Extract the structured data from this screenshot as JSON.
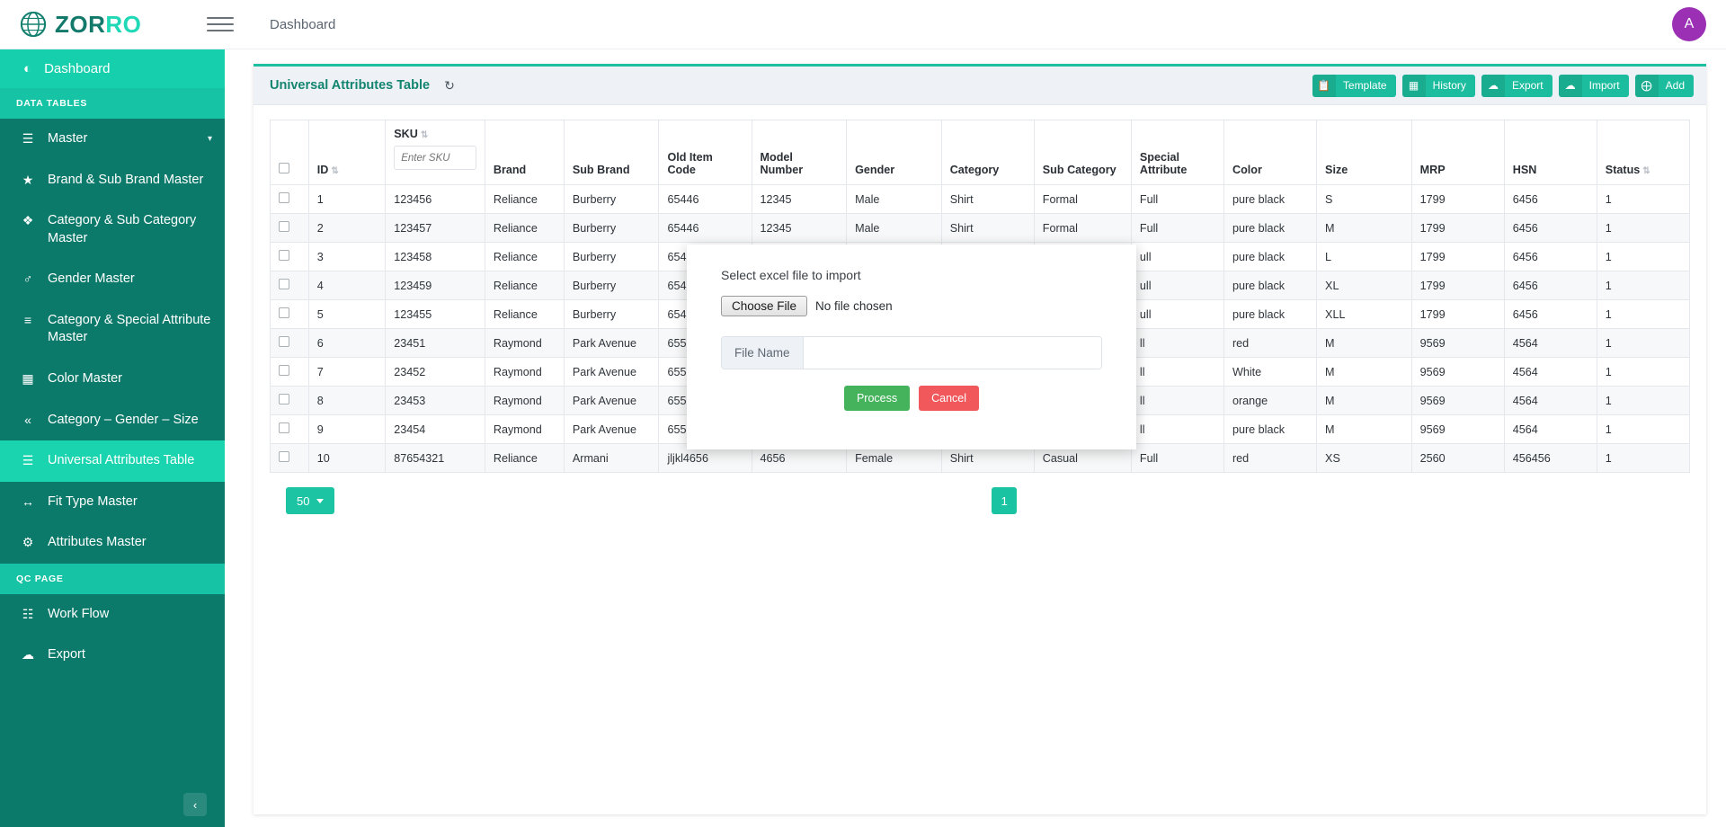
{
  "brand": {
    "text_dark": "ZOR",
    "text_light": "RO",
    "logo_icon": "globe-icon"
  },
  "topbar": {
    "menu_toggle_icon": "hamburger-icon",
    "breadcrumb": "Dashboard",
    "avatar_initial": "A",
    "avatar_color": "#9b30b5"
  },
  "sidebar": {
    "dashboard": {
      "label": "Dashboard",
      "icon": "dashboard-icon"
    },
    "sections": [
      {
        "title": "DATA TABLES",
        "items": [
          {
            "label": "Master",
            "icon": "layers-icon",
            "active": false,
            "chevron": "⌄"
          },
          {
            "label": "Brand & Sub Brand Master",
            "icon": "star-icon",
            "active": false
          },
          {
            "label": "Category & Sub Category Master",
            "icon": "stack-icon",
            "active": false
          },
          {
            "label": "Gender Master",
            "icon": "gender-icon",
            "active": false
          },
          {
            "label": "Category & Special Attribute Master",
            "icon": "sliders-icon",
            "active": false
          },
          {
            "label": "Color Master",
            "icon": "grid-icon",
            "active": false
          },
          {
            "label": "Category – Gender – Size",
            "icon": "chevrons-icon",
            "active": false
          },
          {
            "label": "Universal Attributes Table",
            "icon": "list-icon",
            "active": true
          },
          {
            "label": "Fit Type Master",
            "icon": "arrows-h-icon",
            "active": false
          },
          {
            "label": "Attributes Master",
            "icon": "cogs-icon",
            "active": false
          }
        ]
      },
      {
        "title": "QC PAGE",
        "items": [
          {
            "label": "Work Flow",
            "icon": "tasks-icon",
            "active": false
          },
          {
            "label": "Export",
            "icon": "cloud-upload-icon",
            "active": false
          }
        ]
      }
    ],
    "collapse_icon": "‹"
  },
  "card": {
    "title": "Universal Attributes Table",
    "refresh_icon": "refresh-icon",
    "accent_color": "#1dbfa0",
    "actions": [
      {
        "label": "Template",
        "icon": "copy-icon"
      },
      {
        "label": "History",
        "icon": "table-icon"
      },
      {
        "label": "Export",
        "icon": "cloud-upload-icon"
      },
      {
        "label": "Import",
        "icon": "cloud-download-icon"
      },
      {
        "label": "Add",
        "icon": "plus-circle-icon"
      }
    ]
  },
  "table": {
    "select_all_checkbox": false,
    "sku_filter": {
      "value": "",
      "placeholder": "Enter SKU"
    },
    "columns": [
      {
        "key": "cb",
        "label": "",
        "sortable": false
      },
      {
        "key": "id",
        "label": "ID",
        "sortable": true
      },
      {
        "key": "sku",
        "label": "SKU",
        "sortable": true,
        "filter": true
      },
      {
        "key": "brand",
        "label": "Brand",
        "sortable": false
      },
      {
        "key": "sub_brand",
        "label": "Sub Brand",
        "sortable": false
      },
      {
        "key": "old_item_code",
        "label": "Old Item Code",
        "sortable": false
      },
      {
        "key": "model_number",
        "label": "Model Number",
        "sortable": false
      },
      {
        "key": "gender",
        "label": "Gender",
        "sortable": false
      },
      {
        "key": "category",
        "label": "Category",
        "sortable": false
      },
      {
        "key": "sub_category",
        "label": "Sub Category",
        "sortable": false
      },
      {
        "key": "special_attribute",
        "label": "Special Attribute",
        "sortable": false
      },
      {
        "key": "color",
        "label": "Color",
        "sortable": false
      },
      {
        "key": "size",
        "label": "Size",
        "sortable": false
      },
      {
        "key": "mrp",
        "label": "MRP",
        "sortable": false
      },
      {
        "key": "hsn",
        "label": "HSN",
        "sortable": false
      },
      {
        "key": "status",
        "label": "Status",
        "sortable": true
      }
    ],
    "rows": [
      {
        "id": "1",
        "sku": "123456",
        "brand": "Reliance",
        "sub_brand": "Burberry",
        "old_item_code": "65446",
        "model_number": "12345",
        "gender": "Male",
        "category": "Shirt",
        "sub_category": "Formal",
        "special_attribute": "Full",
        "color": "pure black",
        "size": "S",
        "mrp": "1799",
        "hsn": "6456",
        "status": "1"
      },
      {
        "id": "2",
        "sku": "123457",
        "brand": "Reliance",
        "sub_brand": "Burberry",
        "old_item_code": "65446",
        "model_number": "12345",
        "gender": "Male",
        "category": "Shirt",
        "sub_category": "Formal",
        "special_attribute": "Full",
        "color": "pure black",
        "size": "M",
        "mrp": "1799",
        "hsn": "6456",
        "status": "1"
      },
      {
        "id": "3",
        "sku": "123458",
        "brand": "Reliance",
        "sub_brand": "Burberry",
        "old_item_code": "654",
        "model_number": "",
        "gender": "",
        "category": "",
        "sub_category": "",
        "special_attribute": "ull",
        "color": "pure black",
        "size": "L",
        "mrp": "1799",
        "hsn": "6456",
        "status": "1"
      },
      {
        "id": "4",
        "sku": "123459",
        "brand": "Reliance",
        "sub_brand": "Burberry",
        "old_item_code": "654",
        "model_number": "",
        "gender": "",
        "category": "",
        "sub_category": "",
        "special_attribute": "ull",
        "color": "pure black",
        "size": "XL",
        "mrp": "1799",
        "hsn": "6456",
        "status": "1"
      },
      {
        "id": "5",
        "sku": "123455",
        "brand": "Reliance",
        "sub_brand": "Burberry",
        "old_item_code": "654",
        "model_number": "",
        "gender": "",
        "category": "",
        "sub_category": "",
        "special_attribute": "ull",
        "color": "pure black",
        "size": "XLL",
        "mrp": "1799",
        "hsn": "6456",
        "status": "1"
      },
      {
        "id": "6",
        "sku": "23451",
        "brand": "Raymond",
        "sub_brand": "Park Avenue",
        "old_item_code": "655",
        "model_number": "",
        "gender": "",
        "category": "",
        "sub_category": "",
        "special_attribute": "ll",
        "color": "red",
        "size": "M",
        "mrp": "9569",
        "hsn": "4564",
        "status": "1"
      },
      {
        "id": "7",
        "sku": "23452",
        "brand": "Raymond",
        "sub_brand": "Park Avenue",
        "old_item_code": "655",
        "model_number": "",
        "gender": "",
        "category": "",
        "sub_category": "",
        "special_attribute": "ll",
        "color": "White",
        "size": "M",
        "mrp": "9569",
        "hsn": "4564",
        "status": "1"
      },
      {
        "id": "8",
        "sku": "23453",
        "brand": "Raymond",
        "sub_brand": "Park Avenue",
        "old_item_code": "655",
        "model_number": "",
        "gender": "",
        "category": "",
        "sub_category": "",
        "special_attribute": "ll",
        "color": "orange",
        "size": "M",
        "mrp": "9569",
        "hsn": "4564",
        "status": "1"
      },
      {
        "id": "9",
        "sku": "23454",
        "brand": "Raymond",
        "sub_brand": "Park Avenue",
        "old_item_code": "655",
        "model_number": "",
        "gender": "",
        "category": "",
        "sub_category": "",
        "special_attribute": "ll",
        "color": "pure black",
        "size": "M",
        "mrp": "9569",
        "hsn": "4564",
        "status": "1"
      },
      {
        "id": "10",
        "sku": "87654321",
        "brand": "Reliance",
        "sub_brand": "Armani",
        "old_item_code": "jljkl4656",
        "model_number": "4656",
        "gender": "Female",
        "category": "Shirt",
        "sub_category": "Casual",
        "special_attribute": "Full",
        "color": "red",
        "size": "XS",
        "mrp": "2560",
        "hsn": "456456",
        "status": "1"
      }
    ]
  },
  "pagination": {
    "per_page": "50",
    "per_page_caret": "caret-down-icon",
    "pages": [
      "1"
    ],
    "current_page": "1"
  },
  "modal": {
    "label": "Select excel file to import",
    "choose_file_button": "Choose File",
    "no_file_text": "No file chosen",
    "file_name_addon": "File Name",
    "file_name_value": "",
    "process_button": "Process",
    "cancel_button": "Cancel",
    "process_color": "#45b35c",
    "cancel_color": "#f0585c"
  }
}
